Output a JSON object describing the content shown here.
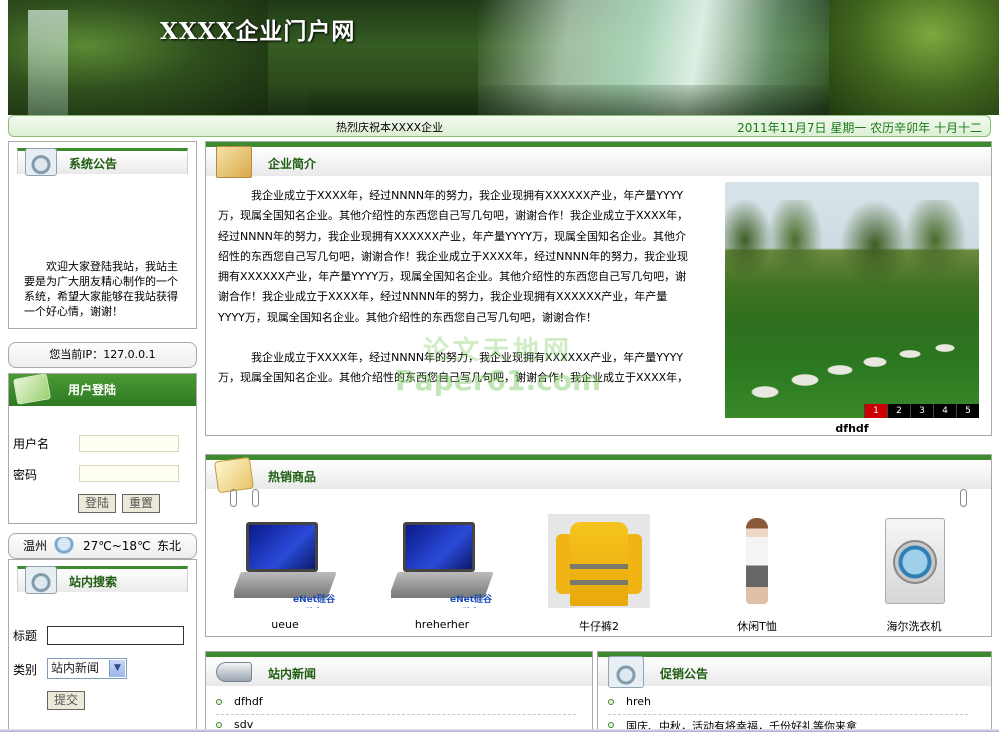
{
  "banner": {
    "title": "XXXX企业门户网"
  },
  "infobar": {
    "welcome": "热烈庆祝本XXXX企业",
    "date": "2011年11月7日  星期一  农历辛卯年  十月十二"
  },
  "notice": {
    "title": "系统公告",
    "text": "欢迎大家登陆我站，我站主要是为广大朋友精心制作的一个系统，希望大家能够在我站获得一个好心情，谢谢！"
  },
  "ip": {
    "text": "您当前IP：127.0.0.1"
  },
  "login": {
    "title": "用户登陆",
    "username_label": "用户名",
    "password_label": "密码",
    "login_button": "登陆",
    "reset_button": "重置"
  },
  "weather": {
    "city": "温州",
    "temp": "27℃~18℃",
    "wind": "东北",
    "icon": "cloud-rain-icon"
  },
  "search": {
    "title": "站内搜索",
    "title_label": "标题",
    "category_label": "类别",
    "category_selected": "站内新闻",
    "submit_button": "提交"
  },
  "intro": {
    "title": "企业简介",
    "para1": "我企业成立于XXXX年，经过NNNN年的努力，我企业现拥有XXXXXX产业，年产量YYYY万，现属全国知名企业。其他介绍性的东西您自己写几句吧，谢谢合作！我企业成立于XXXX年，经过NNNN年的努力，我企业现拥有XXXXXX产业，年产量YYYY万，现属全国知名企业。其他介绍性的东西您自己写几句吧，谢谢合作！我企业成立于XXXX年，经过NNNN年的努力，我企业现拥有XXXXXX产业，年产量YYYY万，现属全国知名企业。其他介绍性的东西您自己写几句吧，谢谢合作！我企业成立于XXXX年，经过NNNN年的努力，我企业现拥有XXXXXX产业，年产量YYYY万，现属全国知名企业。其他介绍性的东西您自己写几句吧，谢谢合作！",
    "para2": "我企业成立于XXXX年，经过NNNN年的努力，我企业现拥有XXXXXX产业，年产量YYYY万，现属全国知名企业。其他介绍性的东西您自己写几句吧，谢谢合作！我企业成立于XXXX年，",
    "photo_caption": "dfhdf",
    "pager": [
      "1",
      "2",
      "3",
      "4",
      "5"
    ],
    "watermark_cn": "论文天地网",
    "watermark_en": "Paper61.com"
  },
  "goods": {
    "title": "热销商品",
    "items": [
      {
        "label": "ueue"
      },
      {
        "label": "hreherher"
      },
      {
        "label": "牛仔裤2"
      },
      {
        "label": "休闲T恤"
      },
      {
        "label": "海尔洗衣机"
      }
    ],
    "brand_tag": "eNet硅谷动力"
  },
  "news": {
    "title": "站内新闻",
    "items": [
      "dfhdf",
      "sdv"
    ]
  },
  "promo": {
    "title": "促销公告",
    "items": [
      "hreh",
      "国庆、中秋，活动有将幸福，千份好礼等你来拿"
    ]
  },
  "colors": {
    "accent": "#3e8a2e",
    "title_green": "#1f5d10",
    "date_green": "#1b7a1b"
  }
}
